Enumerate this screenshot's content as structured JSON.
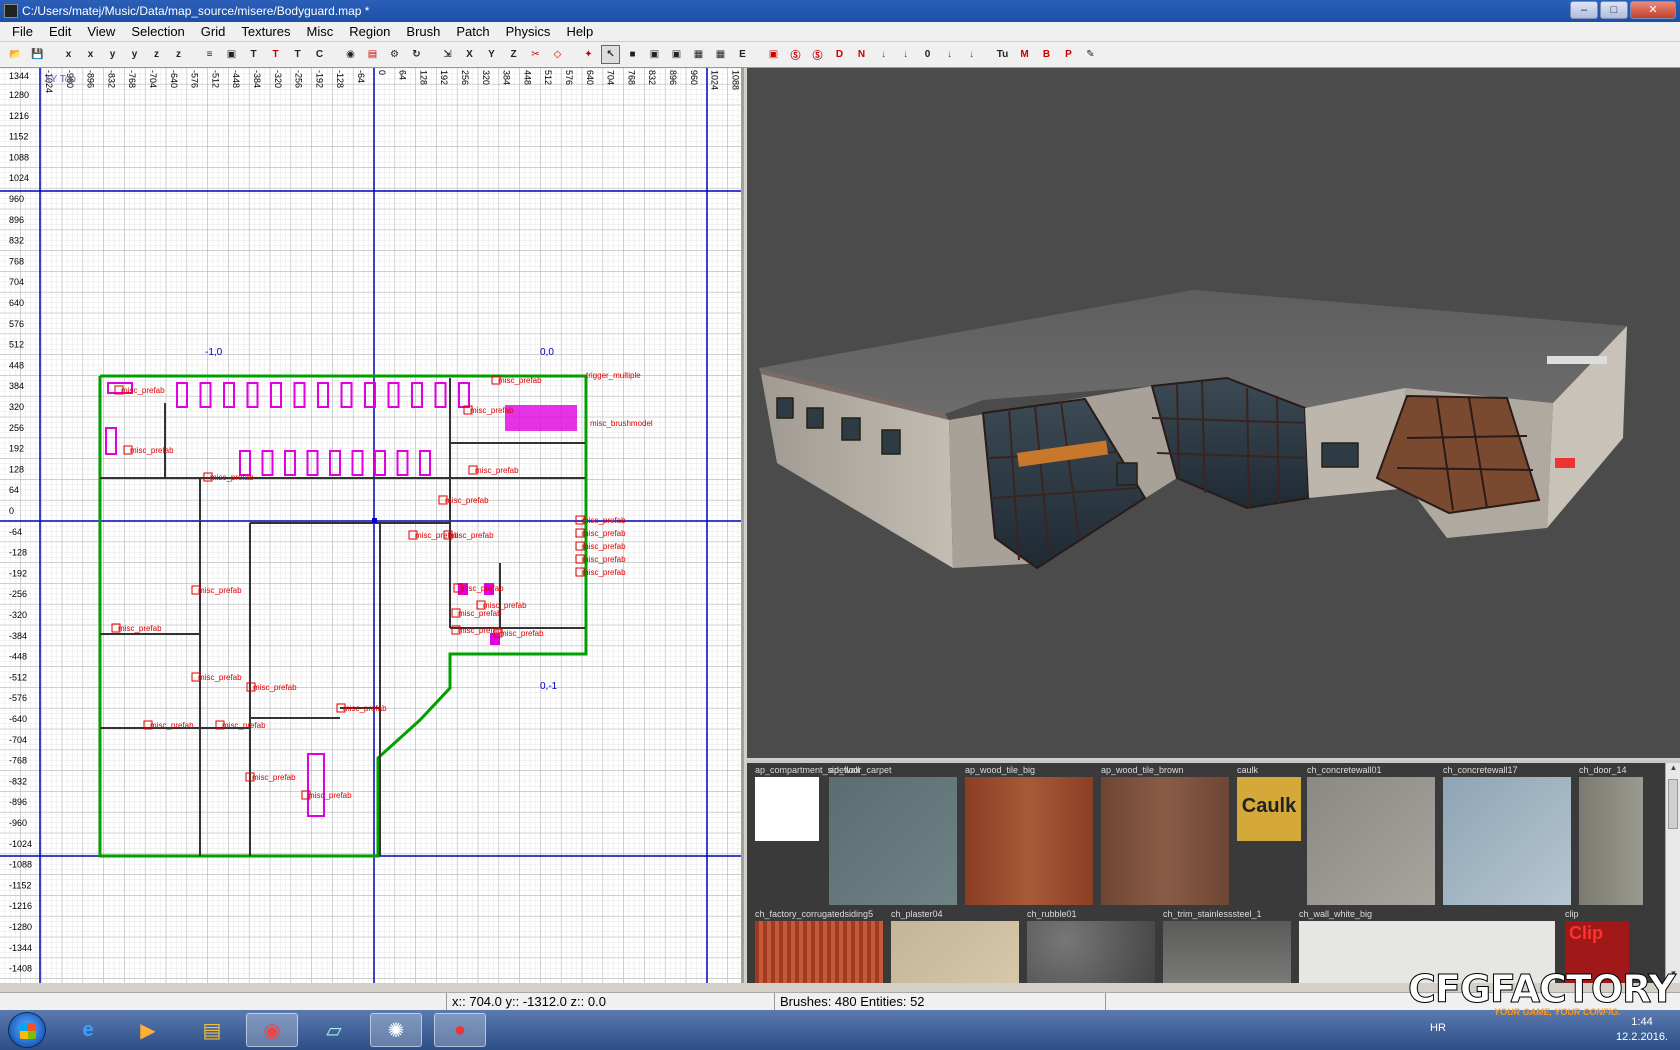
{
  "window": {
    "title": "C:/Users/matej/Music/Data/map_source/misere/Bodyguard.map *",
    "minimize": "–",
    "maximize": "□",
    "close": "✕"
  },
  "menu": [
    "File",
    "Edit",
    "View",
    "Selection",
    "Grid",
    "Textures",
    "Misc",
    "Region",
    "Brush",
    "Patch",
    "Physics",
    "Help"
  ],
  "toolbar": {
    "buttons": [
      {
        "icon": "open-icon",
        "glyph": "📂"
      },
      {
        "icon": "save-icon",
        "glyph": "💾"
      },
      {
        "icon": "flip-x-icon",
        "glyph": "x"
      },
      {
        "icon": "rotate-x-icon",
        "glyph": "x"
      },
      {
        "icon": "flip-y-icon",
        "glyph": "y"
      },
      {
        "icon": "rotate-y-icon",
        "glyph": "y"
      },
      {
        "icon": "flip-z-icon",
        "glyph": "z"
      },
      {
        "icon": "rotate-z-icon",
        "glyph": "z"
      },
      {
        "icon": "csg-icon",
        "glyph": "≡"
      },
      {
        "icon": "hollow-icon",
        "glyph": "▣"
      },
      {
        "icon": "tex-fit-icon",
        "glyph": "T"
      },
      {
        "icon": "tex-flip-icon",
        "glyph": "T"
      },
      {
        "icon": "tex-scale-icon",
        "glyph": "T"
      },
      {
        "icon": "cycle-layer-icon",
        "glyph": "C"
      },
      {
        "icon": "view-change-icon",
        "glyph": "◉"
      },
      {
        "icon": "cubic-clip-icon",
        "glyph": "▤"
      },
      {
        "icon": "camera-icon",
        "glyph": "⚙"
      },
      {
        "icon": "rotate-icon",
        "glyph": "↻"
      },
      {
        "icon": "scale-icon",
        "glyph": "⇲"
      },
      {
        "icon": "view-x-icon",
        "glyph": "X"
      },
      {
        "icon": "view-y-icon",
        "glyph": "Y"
      },
      {
        "icon": "view-z-icon",
        "glyph": "Z"
      },
      {
        "icon": "clipper-icon",
        "glyph": "✂"
      },
      {
        "icon": "drag-edge-icon",
        "glyph": "◇"
      },
      {
        "icon": "drag-vertex-icon",
        "glyph": "✦"
      },
      {
        "icon": "select-icon",
        "glyph": "↖"
      },
      {
        "icon": "patch-icon",
        "glyph": "■"
      },
      {
        "icon": "lock-icon",
        "glyph": "▣"
      },
      {
        "icon": "texture-lock-icon",
        "glyph": "▣"
      },
      {
        "icon": "entity-icon",
        "glyph": "▦"
      },
      {
        "icon": "grid-icon",
        "glyph": "▦"
      },
      {
        "icon": "filter-icon",
        "glyph": "E"
      },
      {
        "icon": "toggle-a-icon",
        "glyph": "▣"
      },
      {
        "icon": "toggle-b-icon",
        "glyph": "Ⓢ"
      },
      {
        "icon": "toggle-c-icon",
        "glyph": "Ⓢ"
      },
      {
        "icon": "toggle-d-icon",
        "glyph": "D"
      },
      {
        "icon": "toggle-n-icon",
        "glyph": "N"
      },
      {
        "icon": "arrow-down-icon",
        "glyph": "↓"
      },
      {
        "icon": "arrow-down2-icon",
        "glyph": "↓"
      },
      {
        "icon": "zero-icon",
        "glyph": "0"
      },
      {
        "icon": "bevel-icon",
        "glyph": "↓"
      },
      {
        "icon": "endcap-icon",
        "glyph": "↓"
      },
      {
        "icon": "tu-icon",
        "glyph": "Tu"
      },
      {
        "icon": "m-icon",
        "glyph": "M"
      },
      {
        "icon": "b-icon",
        "glyph": "B"
      },
      {
        "icon": "p-icon",
        "glyph": "P"
      },
      {
        "icon": "tools-icon",
        "glyph": "✎"
      }
    ]
  },
  "grid_view": {
    "top_labels": [
      "-1024",
      "-960",
      "-896",
      "-832",
      "-768",
      "-704",
      "-640",
      "-576",
      "-512",
      "-448",
      "-384",
      "-320",
      "-256",
      "-192",
      "-128",
      "-64",
      "0",
      "64",
      "128",
      "192",
      "256",
      "320",
      "384",
      "448",
      "512",
      "576",
      "640",
      "704",
      "768",
      "832",
      "896",
      "960",
      "1024",
      "1088"
    ],
    "left_labels": [
      "1280",
      "1216",
      "1152",
      "1088",
      "1024",
      "960",
      "896",
      "832",
      "768",
      "704",
      "640",
      "576",
      "512",
      "448",
      "384",
      "320",
      "256",
      "192",
      "128",
      "64",
      "0",
      "-64",
      "-128",
      "-192",
      "-256",
      "-320",
      "-384",
      "-448",
      "-512",
      "-576",
      "-640",
      "-704",
      "-768",
      "-832",
      "-896",
      "-960",
      "-1024",
      "-1088",
      "-1152",
      "-1216",
      "-1280",
      "-1344",
      "-1408"
    ],
    "top_corner": "1344",
    "view_label": "XY Top",
    "region_labels": [
      "-1,0",
      "0,0",
      "0,-1"
    ],
    "entity_label": "misc_prefab",
    "model_label": "misc_brushmodel",
    "trigger_label": "trigger_multiple"
  },
  "textures": [
    {
      "name": "ap_compartment_sidewall",
      "kind": "white"
    },
    {
      "name": "ap_floor_carpet",
      "kind": "carpet"
    },
    {
      "name": "ap_wood_tile_big",
      "kind": "wood"
    },
    {
      "name": "ap_wood_tile_brown",
      "kind": "woodbrown"
    },
    {
      "name": "caulk",
      "kind": "caulk",
      "text": "Caulk"
    },
    {
      "name": "ch_concretewall01",
      "kind": "concrete"
    },
    {
      "name": "ch_concretewall17",
      "kind": "concreteblue"
    },
    {
      "name": "ch_door_14",
      "kind": "door"
    },
    {
      "name": "ch_factory_corrugatedsiding5",
      "kind": "corrugated"
    },
    {
      "name": "ch_plaster04",
      "kind": "plaster"
    },
    {
      "name": "ch_rubble01",
      "kind": "rubble"
    },
    {
      "name": "ch_trim_stainlesssteel_1",
      "kind": "steel"
    },
    {
      "name": "ch_wall_white_big",
      "kind": "whitewall"
    },
    {
      "name": "clip",
      "kind": "clip",
      "text": "Clip"
    }
  ],
  "status": {
    "coords": "x:: 704.0  y:: -1312.0  z:: 0.0",
    "counts": "Brushes: 480 Entities: 52"
  },
  "taskbar": {
    "apps": [
      "internet-explorer",
      "media-player",
      "file-explorer",
      "chrome",
      "notepad",
      "radiant",
      "recorder"
    ],
    "lang": "HR",
    "time": "1:44",
    "date": "12.2.2016."
  },
  "watermark": {
    "text": "CFGFACTORY",
    "tagline": "YOUR GAME, YOUR CONFIG."
  },
  "colors": {
    "axis_blue": "#0000c0",
    "brush_green": "#00a000",
    "entity_red": "#e00000",
    "prefab_magenta": "#e000e0",
    "cam_bg": "#4b4b4b"
  }
}
